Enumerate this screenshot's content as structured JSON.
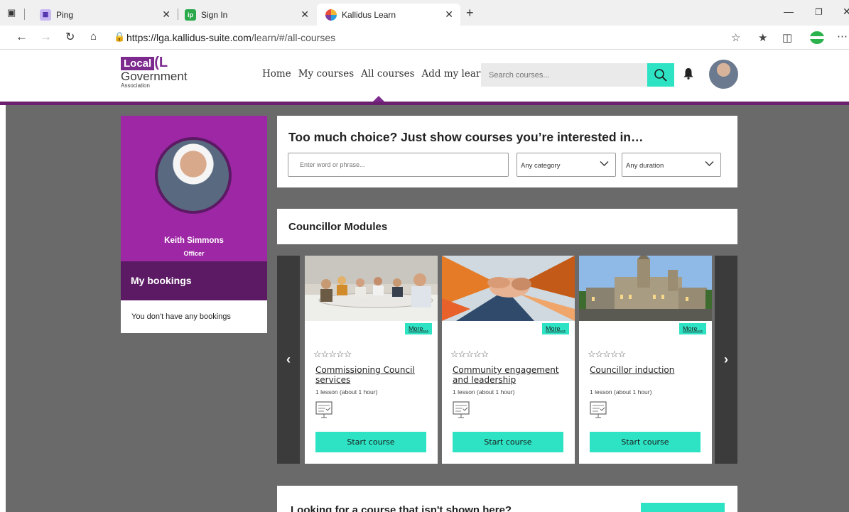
{
  "browser": {
    "tabs": [
      {
        "label": "Ping",
        "icon": "ping-icon"
      },
      {
        "label": "Sign In",
        "icon": "signin-icon"
      },
      {
        "label": "Kallidus Learn",
        "icon": "kallidus-icon"
      }
    ],
    "url_host": "https://lga.kallidus-suite.com",
    "url_path": "/learn/#/all-courses"
  },
  "header": {
    "logo": {
      "line1": "Local",
      "line2": "Government",
      "line3": "Association"
    },
    "nav": [
      "Home",
      "My courses",
      "All courses",
      "Add my learning"
    ],
    "search_placeholder": "Search courses..."
  },
  "profile": {
    "name": "Keith Simmons",
    "role": "Officer",
    "bookings_title": "My bookings",
    "bookings_empty": "You don't have any bookings"
  },
  "filter": {
    "title": "Too much choice? Just show courses you’re interested in…",
    "input_placeholder": "Enter word or phrase...",
    "category": "Any category",
    "duration": "Any duration"
  },
  "section": {
    "title": "Councillor Modules"
  },
  "courses": [
    {
      "title": "Commissioning Council services",
      "meta": "1 lesson (about 1 hour)",
      "more": "More...",
      "start": "Start course"
    },
    {
      "title": "Community engagement and leadership",
      "meta": "1 lesson (about 1 hour)",
      "more": "More...",
      "start": "Start course"
    },
    {
      "title": "Councillor induction",
      "meta": "1 lesson (about 1 hour)",
      "more": "More...",
      "start": "Start course"
    }
  ],
  "bottom": {
    "title": "Looking for a course that isn't shown here?"
  },
  "colors": {
    "purple": "#9e27a6",
    "dark_purple": "#5b1a63",
    "accent": "#2de3c4"
  }
}
